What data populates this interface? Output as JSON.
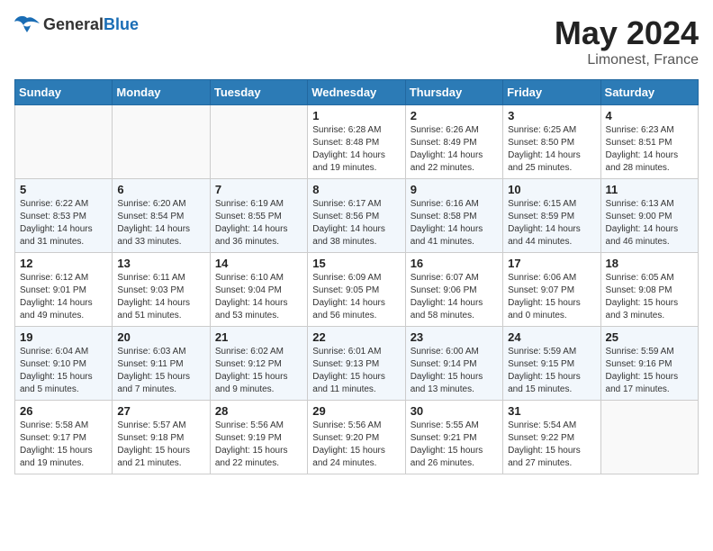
{
  "header": {
    "logo_general": "General",
    "logo_blue": "Blue",
    "title": "May 2024",
    "location": "Limonest, France"
  },
  "weekdays": [
    "Sunday",
    "Monday",
    "Tuesday",
    "Wednesday",
    "Thursday",
    "Friday",
    "Saturday"
  ],
  "weeks": [
    [
      {
        "day": "",
        "info": ""
      },
      {
        "day": "",
        "info": ""
      },
      {
        "day": "",
        "info": ""
      },
      {
        "day": "1",
        "info": "Sunrise: 6:28 AM\nSunset: 8:48 PM\nDaylight: 14 hours\nand 19 minutes."
      },
      {
        "day": "2",
        "info": "Sunrise: 6:26 AM\nSunset: 8:49 PM\nDaylight: 14 hours\nand 22 minutes."
      },
      {
        "day": "3",
        "info": "Sunrise: 6:25 AM\nSunset: 8:50 PM\nDaylight: 14 hours\nand 25 minutes."
      },
      {
        "day": "4",
        "info": "Sunrise: 6:23 AM\nSunset: 8:51 PM\nDaylight: 14 hours\nand 28 minutes."
      }
    ],
    [
      {
        "day": "5",
        "info": "Sunrise: 6:22 AM\nSunset: 8:53 PM\nDaylight: 14 hours\nand 31 minutes."
      },
      {
        "day": "6",
        "info": "Sunrise: 6:20 AM\nSunset: 8:54 PM\nDaylight: 14 hours\nand 33 minutes."
      },
      {
        "day": "7",
        "info": "Sunrise: 6:19 AM\nSunset: 8:55 PM\nDaylight: 14 hours\nand 36 minutes."
      },
      {
        "day": "8",
        "info": "Sunrise: 6:17 AM\nSunset: 8:56 PM\nDaylight: 14 hours\nand 38 minutes."
      },
      {
        "day": "9",
        "info": "Sunrise: 6:16 AM\nSunset: 8:58 PM\nDaylight: 14 hours\nand 41 minutes."
      },
      {
        "day": "10",
        "info": "Sunrise: 6:15 AM\nSunset: 8:59 PM\nDaylight: 14 hours\nand 44 minutes."
      },
      {
        "day": "11",
        "info": "Sunrise: 6:13 AM\nSunset: 9:00 PM\nDaylight: 14 hours\nand 46 minutes."
      }
    ],
    [
      {
        "day": "12",
        "info": "Sunrise: 6:12 AM\nSunset: 9:01 PM\nDaylight: 14 hours\nand 49 minutes."
      },
      {
        "day": "13",
        "info": "Sunrise: 6:11 AM\nSunset: 9:03 PM\nDaylight: 14 hours\nand 51 minutes."
      },
      {
        "day": "14",
        "info": "Sunrise: 6:10 AM\nSunset: 9:04 PM\nDaylight: 14 hours\nand 53 minutes."
      },
      {
        "day": "15",
        "info": "Sunrise: 6:09 AM\nSunset: 9:05 PM\nDaylight: 14 hours\nand 56 minutes."
      },
      {
        "day": "16",
        "info": "Sunrise: 6:07 AM\nSunset: 9:06 PM\nDaylight: 14 hours\nand 58 minutes."
      },
      {
        "day": "17",
        "info": "Sunrise: 6:06 AM\nSunset: 9:07 PM\nDaylight: 15 hours\nand 0 minutes."
      },
      {
        "day": "18",
        "info": "Sunrise: 6:05 AM\nSunset: 9:08 PM\nDaylight: 15 hours\nand 3 minutes."
      }
    ],
    [
      {
        "day": "19",
        "info": "Sunrise: 6:04 AM\nSunset: 9:10 PM\nDaylight: 15 hours\nand 5 minutes."
      },
      {
        "day": "20",
        "info": "Sunrise: 6:03 AM\nSunset: 9:11 PM\nDaylight: 15 hours\nand 7 minutes."
      },
      {
        "day": "21",
        "info": "Sunrise: 6:02 AM\nSunset: 9:12 PM\nDaylight: 15 hours\nand 9 minutes."
      },
      {
        "day": "22",
        "info": "Sunrise: 6:01 AM\nSunset: 9:13 PM\nDaylight: 15 hours\nand 11 minutes."
      },
      {
        "day": "23",
        "info": "Sunrise: 6:00 AM\nSunset: 9:14 PM\nDaylight: 15 hours\nand 13 minutes."
      },
      {
        "day": "24",
        "info": "Sunrise: 5:59 AM\nSunset: 9:15 PM\nDaylight: 15 hours\nand 15 minutes."
      },
      {
        "day": "25",
        "info": "Sunrise: 5:59 AM\nSunset: 9:16 PM\nDaylight: 15 hours\nand 17 minutes."
      }
    ],
    [
      {
        "day": "26",
        "info": "Sunrise: 5:58 AM\nSunset: 9:17 PM\nDaylight: 15 hours\nand 19 minutes."
      },
      {
        "day": "27",
        "info": "Sunrise: 5:57 AM\nSunset: 9:18 PM\nDaylight: 15 hours\nand 21 minutes."
      },
      {
        "day": "28",
        "info": "Sunrise: 5:56 AM\nSunset: 9:19 PM\nDaylight: 15 hours\nand 22 minutes."
      },
      {
        "day": "29",
        "info": "Sunrise: 5:56 AM\nSunset: 9:20 PM\nDaylight: 15 hours\nand 24 minutes."
      },
      {
        "day": "30",
        "info": "Sunrise: 5:55 AM\nSunset: 9:21 PM\nDaylight: 15 hours\nand 26 minutes."
      },
      {
        "day": "31",
        "info": "Sunrise: 5:54 AM\nSunset: 9:22 PM\nDaylight: 15 hours\nand 27 minutes."
      },
      {
        "day": "",
        "info": ""
      }
    ]
  ]
}
